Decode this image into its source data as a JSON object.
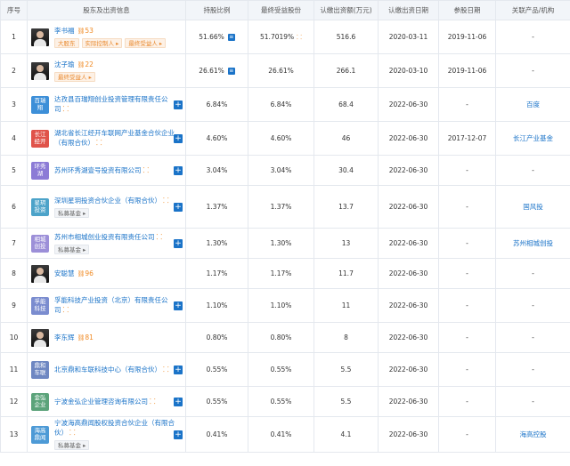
{
  "headers": [
    "序号",
    "股东及出资信息",
    "持股比例",
    "最终受益股份",
    "认缴出资额(万元)",
    "认缴出资日期",
    "参股日期",
    "关联产品/机构"
  ],
  "rows": [
    {
      "no": "1",
      "type": "person",
      "name": "李书福",
      "boss": "53",
      "tags": [
        "大股东",
        "实际控制人 ▸",
        "最终受益人 ▸"
      ],
      "ratio": "51.66%",
      "ratio_icon": true,
      "benefit": "51.7019%",
      "benefit_icon": true,
      "amount": "516.6",
      "date": "2020-03-11",
      "join": "2019-11-06",
      "product": "-"
    },
    {
      "no": "2",
      "type": "person",
      "name": "沈子瑜",
      "boss": "22",
      "tags": [
        "最终受益人 ▸"
      ],
      "ratio": "26.61%",
      "ratio_icon": true,
      "benefit": "26.61%",
      "benefit_icon": false,
      "amount": "266.1",
      "date": "2020-03-10",
      "join": "2019-11-06",
      "product": "-"
    },
    {
      "no": "3",
      "type": "org",
      "logo": "百瑞翔",
      "logo_color": "#3d8fd8",
      "name": "达孜县百瑞翔创业投资管理有限责任公司",
      "tree": true,
      "tags": [],
      "ratio": "6.84%",
      "benefit": "6.84%",
      "amount": "68.4",
      "date": "2022-06-30",
      "join": "-",
      "product": "百度",
      "product_link": true
    },
    {
      "no": "4",
      "type": "org",
      "logo": "长江 经开",
      "logo_color": "#e0534a",
      "name": "湖北省长江经开车联网产业基金合伙企业（有限合伙）",
      "tree": true,
      "tags": [],
      "ratio": "4.60%",
      "benefit": "4.60%",
      "amount": "46",
      "date": "2022-06-30",
      "join": "2017-12-07",
      "product": "长江产业基金",
      "product_link": true
    },
    {
      "no": "5",
      "type": "org",
      "logo": "环秀 湖",
      "logo_color": "#8c7bd6",
      "name": "苏州环秀湖壹号投资有限公司",
      "tree": true,
      "tags": [],
      "ratio": "3.04%",
      "benefit": "3.04%",
      "amount": "30.4",
      "date": "2022-06-30",
      "join": "-",
      "product": "-"
    },
    {
      "no": "6",
      "type": "org",
      "logo": "星玥 投资",
      "logo_color": "#4ca3c9",
      "name": "深圳星玥投资合伙企业（有限合伙）",
      "tree": true,
      "tags": [
        "私募基金 ▸"
      ],
      "ratio": "1.37%",
      "benefit": "1.37%",
      "amount": "13.7",
      "date": "2022-06-30",
      "join": "-",
      "product": "国风投",
      "product_link": true
    },
    {
      "no": "7",
      "type": "org",
      "logo": "相城 创投",
      "logo_color": "#9c8fd8",
      "name": "苏州市相城创业投资有限责任公司",
      "tree": true,
      "tags": [
        "私募基金 ▸"
      ],
      "ratio": "1.30%",
      "benefit": "1.30%",
      "amount": "13",
      "date": "2022-06-30",
      "join": "-",
      "product": "苏州相城创投",
      "product_link": true
    },
    {
      "no": "8",
      "type": "person",
      "name": "安聪慧",
      "boss": "96",
      "tags": [],
      "ratio": "1.17%",
      "benefit": "1.17%",
      "amount": "11.7",
      "date": "2022-06-30",
      "join": "-",
      "product": "-"
    },
    {
      "no": "9",
      "type": "org",
      "logo": "孚能 科技",
      "logo_color": "#7a8ccf",
      "name": "孚能科技产业投资（北京）有限责任公司",
      "tree": true,
      "tags": [],
      "ratio": "1.10%",
      "benefit": "1.10%",
      "amount": "11",
      "date": "2022-06-30",
      "join": "-",
      "product": "-"
    },
    {
      "no": "10",
      "type": "person",
      "name": "李东辉",
      "boss": "81",
      "tags": [],
      "ratio": "0.80%",
      "benefit": "0.80%",
      "amount": "8",
      "date": "2022-06-30",
      "join": "-",
      "product": "-"
    },
    {
      "no": "11",
      "type": "org",
      "logo": "鼎和 车联",
      "logo_color": "#6e87c2",
      "name": "北京鼎和车联科技中心（有限合伙）",
      "tree": true,
      "tags": [],
      "ratio": "0.55%",
      "benefit": "0.55%",
      "amount": "5.5",
      "date": "2022-06-30",
      "join": "-",
      "product": "-"
    },
    {
      "no": "12",
      "type": "org",
      "logo": "金弘 企业",
      "logo_color": "#5ba37a",
      "name": "宁波金弘企业管理咨询有限公司",
      "tree": true,
      "tags": [],
      "ratio": "0.55%",
      "benefit": "0.55%",
      "amount": "5.5",
      "date": "2022-06-30",
      "join": "-",
      "product": "-"
    },
    {
      "no": "13",
      "type": "org",
      "logo": "海高 鼎闻",
      "logo_color": "#4d9ad6",
      "name": "宁波海高鼎闻股权投资合伙企业（有限合伙）",
      "tree": true,
      "tags": [
        "私募基金 ▸"
      ],
      "ratio": "0.41%",
      "benefit": "0.41%",
      "amount": "4.1",
      "date": "2022-06-30",
      "join": "-",
      "product": "海高控股",
      "product_link": true
    }
  ]
}
